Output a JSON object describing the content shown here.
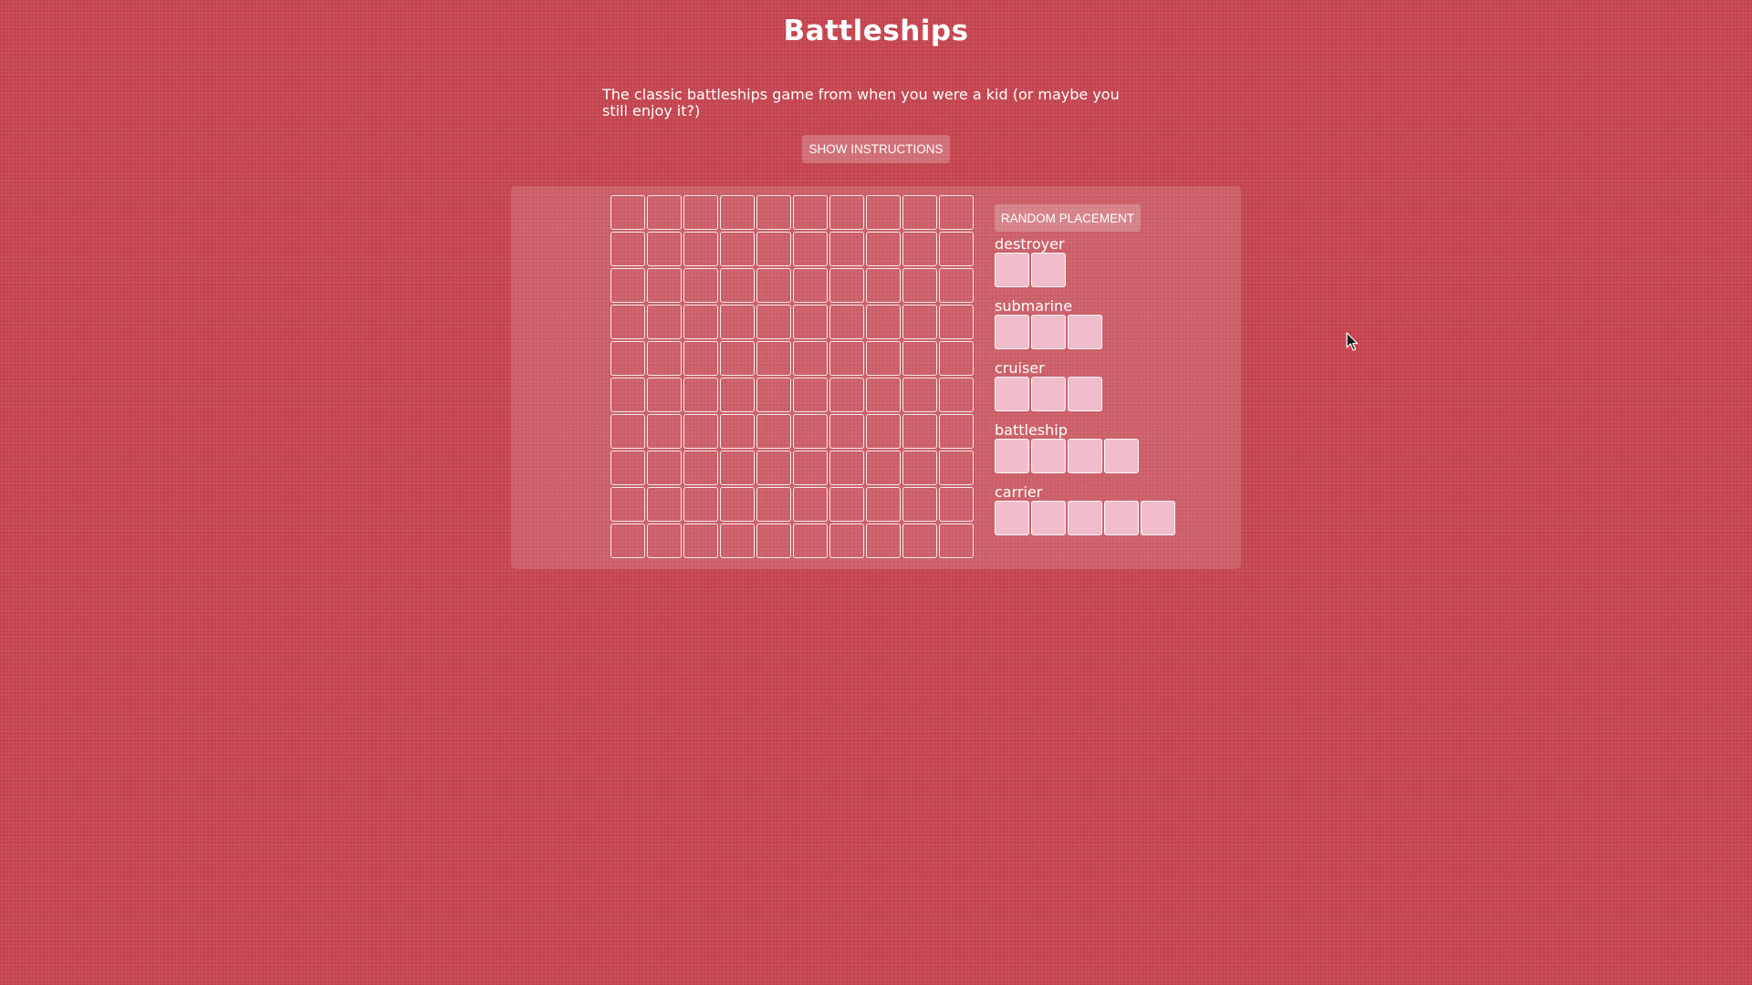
{
  "header": {
    "title": "Battleships",
    "description": "The classic battleships game from when you were a kid (or maybe you still enjoy it?)"
  },
  "controls": {
    "show_instructions_label": "SHOW INSTRUCTIONS",
    "random_placement_label": "RANDOM PLACEMENT"
  },
  "board": {
    "rows": 10,
    "columns": 10
  },
  "ships": [
    {
      "name": "destroyer",
      "size": 2
    },
    {
      "name": "submarine",
      "size": 3
    },
    {
      "name": "cruiser",
      "size": 3
    },
    {
      "name": "battleship",
      "size": 4
    },
    {
      "name": "carrier",
      "size": 5
    }
  ],
  "colors": {
    "background": "#c64752",
    "ship_fill": "#f1bdca",
    "text": "#ffffff"
  },
  "icons": {
    "cursor": "mouse-pointer-icon"
  }
}
